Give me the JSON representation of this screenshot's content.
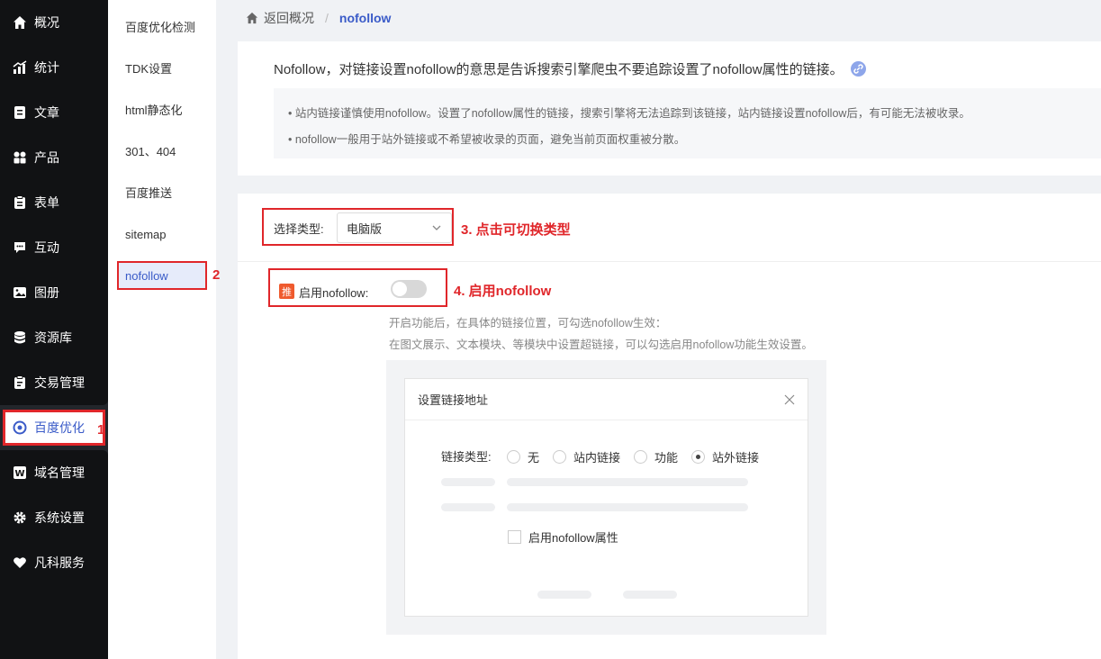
{
  "sidebar": {
    "items": [
      {
        "label": "概况",
        "icon": "home-icon"
      },
      {
        "label": "统计",
        "icon": "stats-icon"
      },
      {
        "label": "文章",
        "icon": "article-icon"
      },
      {
        "label": "产品",
        "icon": "product-icon"
      },
      {
        "label": "表单",
        "icon": "form-icon"
      },
      {
        "label": "互动",
        "icon": "chat-icon"
      },
      {
        "label": "图册",
        "icon": "gallery-icon"
      },
      {
        "label": "资源库",
        "icon": "database-icon"
      },
      {
        "label": "交易管理",
        "icon": "clipboard-icon"
      },
      {
        "label": "百度优化",
        "icon": "seo-icon"
      },
      {
        "label": "域名管理",
        "icon": "domain-icon"
      },
      {
        "label": "系统设置",
        "icon": "gear-icon"
      },
      {
        "label": "凡科服务",
        "icon": "heart-icon"
      }
    ],
    "active_index": 9
  },
  "submenu": {
    "items": [
      "百度优化检测",
      "TDK设置",
      "html静态化",
      "301、404",
      "百度推送",
      "sitemap",
      "nofollow"
    ],
    "active_index": 6
  },
  "annotations": {
    "n1": "1",
    "n2": "2",
    "step3": "3. 点击可切换类型",
    "step4": "4. 启用nofollow"
  },
  "breadcrumb": {
    "back": "返回概况",
    "separator": "/",
    "current": "nofollow"
  },
  "info": {
    "title": "Nofollow，对链接设置nofollow的意思是告诉搜索引擎爬虫不要追踪设置了nofollow属性的链接。",
    "tip1": "• 站内链接谨慎使用nofollow。设置了nofollow属性的链接，搜索引擎将无法追踪到该链接，站内链接设置nofollow后，有可能无法被收录。",
    "tip2": "• nofollow一般用于站外链接或不希望被收录的页面，避免当前页面权重被分散。"
  },
  "settings": {
    "type_label": "选择类型:",
    "type_value": "电脑版",
    "badge": "推",
    "enable_label": "启用nofollow:",
    "toggle_on": false,
    "hint1": "开启功能后，在具体的链接位置，可勾选nofollow生效：",
    "hint2": "在图文展示、文本模块、等模块中设置超链接，可以勾选启用nofollow功能生效设置。"
  },
  "dialog": {
    "title": "设置链接地址",
    "link_type_label": "链接类型:",
    "options": [
      "无",
      "站内链接",
      "功能",
      "站外链接"
    ],
    "selected_index": 3,
    "checkbox_label": "启用nofollow属性"
  },
  "colors": {
    "accent": "#3a5bc8",
    "annotation": "#e0262a",
    "sidebar_bg": "#111214"
  }
}
